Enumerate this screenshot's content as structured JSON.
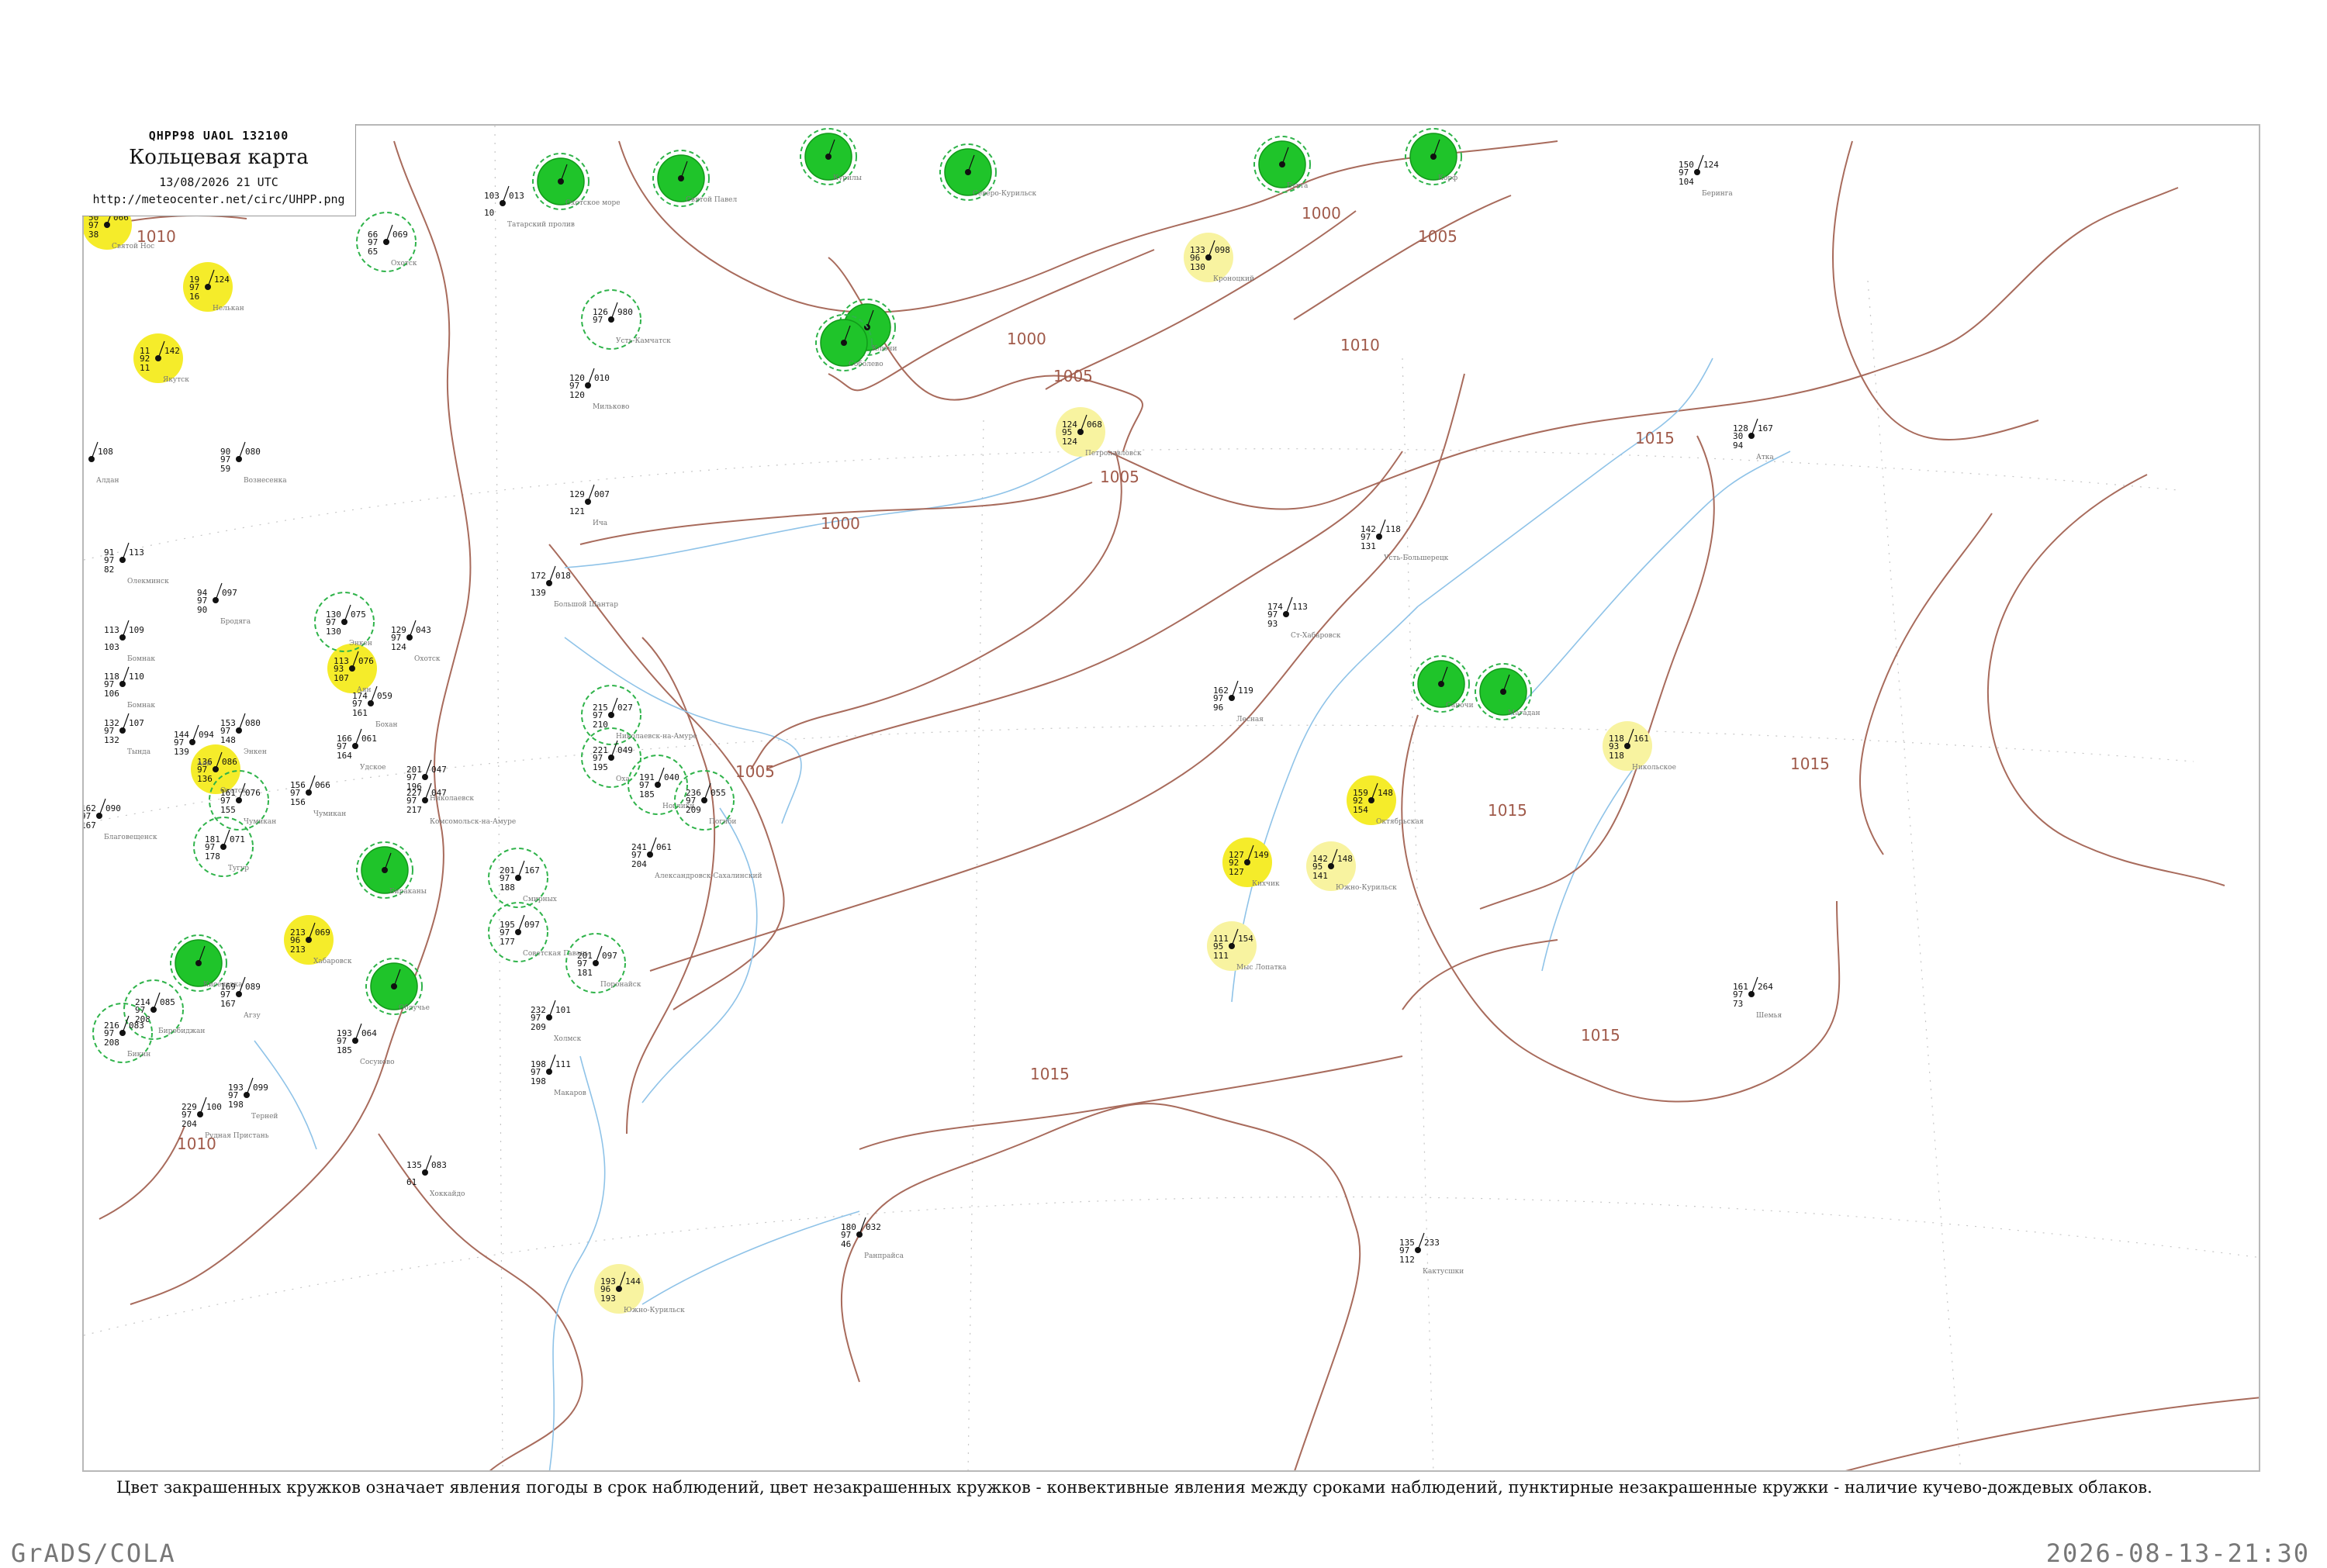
{
  "header": {
    "code_line": "QHPP98  UAOL  132100",
    "title": "Кольцевая карта",
    "datetime": "13/08/2026 21 UTC",
    "url": "http://meteocenter.net/circ/UHPP.png"
  },
  "caption": "Цвет закрашенных кружков означает явления погоды в срок наблюдений, цвет незакрашенных кружков - конвективные явления между сроками наблюдений, пунктирные незакрашенные кружки - наличие кучево-дождевых облаков.",
  "footer": {
    "left": "GrADS/COLA",
    "right": "2026-08-13-21:30"
  },
  "colors": {
    "isobar": "#a86b5c",
    "river": "#8fc3e8",
    "rain_fill": "#f5ec2a",
    "light_fill": "#f8f3a0",
    "storm_fill": "#1fc42a",
    "conv_ring": "#2fb34a"
  },
  "isobar_labels": [
    "1010",
    "1010",
    "1005",
    "1000",
    "1000",
    "1005",
    "1000",
    "1010",
    "1015",
    "1005",
    "1005",
    "1015",
    "1015",
    "1015",
    "1015",
    "1010"
  ],
  "stations": [
    {
      "id": "st-01",
      "kind": "rain",
      "t": "50",
      "p": "066",
      "n": "97",
      "d": "38",
      "name": "Святой Нос"
    },
    {
      "id": "st-02",
      "kind": "rain",
      "t": "19",
      "p": "124",
      "n": "97",
      "d": "16",
      "name": "Нелькан"
    },
    {
      "id": "st-03",
      "kind": "rain",
      "t": "11",
      "p": "142",
      "n": "92",
      "d": "11",
      "name": "Якутск"
    },
    {
      "id": "st-04",
      "kind": "conv",
      "t": "66",
      "p": "069",
      "n": "97",
      "d": "65",
      "name": "Охотск"
    },
    {
      "id": "st-05",
      "kind": "plain",
      "t": "103",
      "p": "013",
      "n": "",
      "d": "10",
      "name": "Татарский пролив"
    },
    {
      "id": "st-06",
      "kind": "storm",
      "t": "",
      "p": "",
      "n": "",
      "d": "",
      "name": "Охотское море"
    },
    {
      "id": "st-07",
      "kind": "storm",
      "t": "",
      "p": "",
      "n": "",
      "d": "",
      "name": "Святой Павел"
    },
    {
      "id": "st-08",
      "kind": "storm",
      "t": "",
      "p": "",
      "n": "",
      "d": "",
      "name": "Курилы"
    },
    {
      "id": "st-09",
      "kind": "storm",
      "t": "",
      "p": "",
      "n": "",
      "d": "",
      "name": "Северо-Курильск"
    },
    {
      "id": "st-10",
      "kind": "storm",
      "t": "",
      "p": "",
      "n": "",
      "d": "",
      "name": "Бухта"
    },
    {
      "id": "st-11",
      "kind": "storm",
      "t": "",
      "p": "",
      "n": "",
      "d": "",
      "name": "Корф"
    },
    {
      "id": "st-12",
      "kind": "light",
      "t": "133",
      "p": "098",
      "n": "96",
      "d": "130",
      "name": "Кроноцкий"
    },
    {
      "id": "st-13",
      "kind": "conv",
      "t": "126",
      "p": "980",
      "n": "97",
      "d": "",
      "name": "Усть-Камчатск"
    },
    {
      "id": "st-14",
      "kind": "storm",
      "t": "",
      "p": "",
      "n": "",
      "d": "",
      "name": "Ключи"
    },
    {
      "id": "st-15",
      "kind": "storm",
      "t": "",
      "p": "",
      "n": "",
      "d": "",
      "name": "Соболево"
    },
    {
      "id": "st-16",
      "kind": "plain",
      "t": "120",
      "p": "010",
      "n": "97",
      "d": "120",
      "name": "Мильково"
    },
    {
      "id": "st-17",
      "kind": "light",
      "t": "124",
      "p": "068",
      "n": "95",
      "d": "124",
      "name": "Петропавловск"
    },
    {
      "id": "st-18",
      "kind": "plain",
      "t": "150",
      "p": "124",
      "n": "97",
      "d": "104",
      "name": "Беринга"
    },
    {
      "id": "st-19",
      "kind": "plain",
      "t": "129",
      "p": "007",
      "n": "",
      "d": "121",
      "name": "Ича"
    },
    {
      "id": "st-20",
      "kind": "plain",
      "t": "172",
      "p": "018",
      "n": "",
      "d": "139",
      "name": "Большой Шантар"
    },
    {
      "id": "st-21",
      "kind": "plain",
      "t": "128",
      "p": "167",
      "n": "30",
      "d": "94",
      "name": "Атка"
    },
    {
      "id": "st-22",
      "kind": "plain",
      "t": "142",
      "p": "118",
      "n": "97",
      "d": "131",
      "name": "Усть-Большерецк"
    },
    {
      "id": "st-23",
      "kind": "plain",
      "t": "174",
      "p": "113",
      "n": "97",
      "d": "93",
      "name": "Ст-Хабаровск"
    },
    {
      "id": "st-24",
      "kind": "storm",
      "t": "",
      "p": "",
      "n": "",
      "d": "",
      "name": "Саночи"
    },
    {
      "id": "st-25",
      "kind": "storm",
      "t": "",
      "p": "",
      "n": "",
      "d": "",
      "name": "Магадан"
    },
    {
      "id": "st-26",
      "kind": "rain",
      "t": "113",
      "p": "076",
      "n": "93",
      "d": "107",
      "name": "Аян"
    },
    {
      "id": "st-27",
      "kind": "conv",
      "t": "130",
      "p": "075",
      "n": "97",
      "d": "130",
      "name": "Энкен"
    },
    {
      "id": "st-28",
      "kind": "plain",
      "t": "162",
      "p": "119",
      "n": "97",
      "d": "96",
      "name": "Лесная"
    },
    {
      "id": "st-29",
      "kind": "light",
      "t": "118",
      "p": "161",
      "n": "93",
      "d": "118",
      "name": "Никольское"
    },
    {
      "id": "st-30",
      "kind": "rain",
      "t": "159",
      "p": "148",
      "n": "92",
      "d": "154",
      "name": "Октябрьская"
    },
    {
      "id": "st-31",
      "kind": "rain",
      "t": "127",
      "p": "149",
      "n": "92",
      "d": "127",
      "name": "Кихчик"
    },
    {
      "id": "st-32",
      "kind": "light",
      "t": "142",
      "p": "148",
      "n": "95",
      "d": "141",
      "name": "Южно-Курильск"
    },
    {
      "id": "st-33",
      "kind": "light",
      "t": "111",
      "p": "154",
      "n": "95",
      "d": "111",
      "name": "Мыс Лопатка"
    },
    {
      "id": "st-34",
      "kind": "conv",
      "t": "215",
      "p": "027",
      "n": "97",
      "d": "210",
      "name": "Николаевск-на-Амуре"
    },
    {
      "id": "st-35",
      "kind": "conv",
      "t": "221",
      "p": "049",
      "n": "97",
      "d": "195",
      "name": "Оха"
    },
    {
      "id": "st-36",
      "kind": "conv",
      "t": "191",
      "p": "040",
      "n": "97",
      "d": "185",
      "name": "Ноглики"
    },
    {
      "id": "st-37",
      "kind": "conv",
      "t": "236",
      "p": "055",
      "n": "97",
      "d": "209",
      "name": "Погиби"
    },
    {
      "id": "st-38",
      "kind": "rain",
      "t": "136",
      "p": "086",
      "n": "97",
      "d": "136",
      "name": "Охотск"
    },
    {
      "id": "st-39",
      "kind": "conv",
      "t": "161",
      "p": "076",
      "n": "97",
      "d": "155",
      "name": "Чумикан"
    },
    {
      "id": "st-40",
      "kind": "conv",
      "t": "181",
      "p": "071",
      "n": "97",
      "d": "178",
      "name": "Тугур"
    },
    {
      "id": "st-41",
      "kind": "storm",
      "t": "",
      "p": "",
      "n": "",
      "d": "",
      "name": "Бираканы"
    },
    {
      "id": "st-42",
      "kind": "storm",
      "t": "",
      "p": "",
      "n": "",
      "d": "",
      "name": "Киселевка"
    },
    {
      "id": "st-43",
      "kind": "rain",
      "t": "213",
      "p": "069",
      "n": "96",
      "d": "213",
      "name": "Хабаровск"
    },
    {
      "id": "st-44",
      "kind": "conv",
      "t": "201",
      "p": "167",
      "n": "97",
      "d": "188",
      "name": "Смирных"
    },
    {
      "id": "st-45",
      "kind": "conv",
      "t": "195",
      "p": "097",
      "n": "97",
      "d": "177",
      "name": "Советская Гавань"
    },
    {
      "id": "st-46",
      "kind": "conv",
      "t": "201",
      "p": "097",
      "n": "97",
      "d": "181",
      "name": "Поронайск"
    },
    {
      "id": "st-47",
      "kind": "plain",
      "t": "241",
      "p": "061",
      "n": "97",
      "d": "204",
      "name": "Александровск-Сахалинский"
    },
    {
      "id": "st-48",
      "kind": "plain",
      "t": "169",
      "p": "089",
      "n": "97",
      "d": "167",
      "name": "Агзу"
    },
    {
      "id": "st-49",
      "kind": "storm",
      "t": "",
      "p": "",
      "n": "",
      "d": "",
      "name": "Облучье"
    },
    {
      "id": "st-50",
      "kind": "conv",
      "t": "214",
      "p": "085",
      "n": "97",
      "d": "208",
      "name": "Биробиджан"
    },
    {
      "id": "st-51",
      "kind": "conv",
      "t": "216",
      "p": "083",
      "n": "97",
      "d": "208",
      "name": "Бикин"
    },
    {
      "id": "st-52",
      "kind": "plain",
      "t": "232",
      "p": "101",
      "n": "97",
      "d": "209",
      "name": "Холмск"
    },
    {
      "id": "st-53",
      "kind": "plain",
      "t": "198",
      "p": "111",
      "n": "97",
      "d": "198",
      "name": "Макаров"
    },
    {
      "id": "st-54",
      "kind": "plain",
      "t": "193",
      "p": "064",
      "n": "97",
      "d": "185",
      "name": "Сосуново"
    },
    {
      "id": "st-55",
      "kind": "plain",
      "t": "193",
      "p": "099",
      "n": "97",
      "d": "198",
      "name": "Терней"
    },
    {
      "id": "st-56",
      "kind": "plain",
      "t": "229",
      "p": "100",
      "n": "97",
      "d": "204",
      "name": "Рудная Пристань"
    },
    {
      "id": "st-57",
      "kind": "plain",
      "t": "135",
      "p": "083",
      "n": "",
      "d": "61",
      "name": "Хоккайдо"
    },
    {
      "id": "st-58",
      "kind": "plain",
      "t": "180",
      "p": "032",
      "n": "97",
      "d": "46",
      "name": "Ранпрайса"
    },
    {
      "id": "st-59",
      "kind": "plain",
      "t": "135",
      "p": "233",
      "n": "97",
      "d": "112",
      "name": "Кактусшки"
    },
    {
      "id": "st-60",
      "kind": "plain",
      "t": "161",
      "p": "264",
      "n": "97",
      "d": "73",
      "name": "Шемья"
    },
    {
      "id": "st-61",
      "kind": "light",
      "t": "193",
      "p": "144",
      "n": "96",
      "d": "193",
      "name": "Южно-Курильск"
    },
    {
      "id": "st-62",
      "kind": "plain",
      "t": "153",
      "p": "080",
      "n": "97",
      "d": "148",
      "name": "Энкен"
    },
    {
      "id": "st-63",
      "kind": "plain",
      "t": "144",
      "p": "094",
      "n": "97",
      "d": "139",
      "name": "Аян"
    },
    {
      "id": "st-64",
      "kind": "plain",
      "t": "166",
      "p": "061",
      "n": "97",
      "d": "164",
      "name": "Удское"
    },
    {
      "id": "st-65",
      "kind": "plain",
      "t": "156",
      "p": "066",
      "n": "97",
      "d": "156",
      "name": "Чумикан"
    },
    {
      "id": "st-66",
      "kind": "plain",
      "t": "129",
      "p": "043",
      "n": "97",
      "d": "124",
      "name": "Охотск"
    },
    {
      "id": "st-67",
      "kind": "plain",
      "t": "201",
      "p": "047",
      "n": "97",
      "d": "196",
      "name": "Николаевск"
    },
    {
      "id": "st-68",
      "kind": "plain",
      "t": "227",
      "p": "047",
      "n": "97",
      "d": "217",
      "name": "Комсомольск-на-Амуре"
    },
    {
      "id": "st-69",
      "kind": "plain",
      "t": "174",
      "p": "059",
      "n": "97",
      "d": "161",
      "name": "Бохан"
    },
    {
      "id": "st-70",
      "kind": "plain",
      "t": "118",
      "p": "110",
      "n": "97",
      "d": "106",
      "name": "Бомнак"
    },
    {
      "id": "st-71",
      "kind": "plain",
      "t": "132",
      "p": "107",
      "n": "97",
      "d": "132",
      "name": "Тында"
    },
    {
      "id": "st-72",
      "kind": "plain",
      "t": "162",
      "p": "090",
      "n": "97",
      "d": "167",
      "name": "Благовещенск"
    },
    {
      "id": "st-73",
      "kind": "plain",
      "t": "113",
      "p": "109",
      "n": "",
      "d": "103",
      "name": "Бомнак"
    },
    {
      "id": "st-74",
      "kind": "plain",
      "t": "91",
      "p": "113",
      "n": "97",
      "d": "82",
      "name": "Олекминск"
    },
    {
      "id": "st-75",
      "kind": "plain",
      "t": "94",
      "p": "097",
      "n": "97",
      "d": "90",
      "name": "Бродяга"
    },
    {
      "id": "st-76",
      "kind": "plain",
      "t": "65",
      "p": "108",
      "n": "97",
      "d": "58",
      "name": "Алдан"
    },
    {
      "id": "st-77",
      "kind": "plain",
      "t": "90",
      "p": "080",
      "n": "97",
      "d": "59",
      "name": "Вознесенка"
    }
  ]
}
